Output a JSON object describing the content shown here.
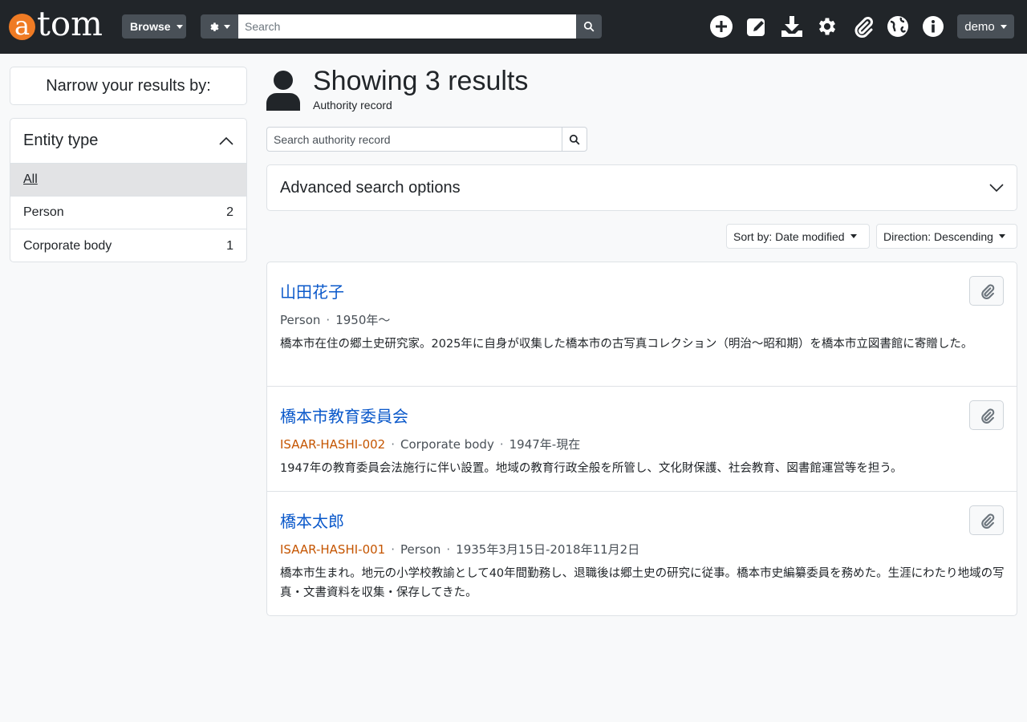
{
  "header": {
    "logo_letter": "a",
    "logo_text": "tom",
    "browse_label": "Browse",
    "search_placeholder": "Search",
    "user_label": "demo",
    "icons": [
      "plus-circle-icon",
      "edit-icon",
      "download-icon",
      "gear-icon",
      "paperclip-icon",
      "globe-icon",
      "info-icon"
    ]
  },
  "sidebar": {
    "narrow_label": "Narrow your results by:",
    "facet": {
      "title": "Entity type",
      "items": [
        {
          "label": "All",
          "count": ""
        },
        {
          "label": "Person",
          "count": "2"
        },
        {
          "label": "Corporate body",
          "count": "1"
        }
      ]
    }
  },
  "main": {
    "title": "Showing 3 results",
    "subtitle": "Authority record",
    "search_placeholder": "Search authority record",
    "advanced_label": "Advanced search options",
    "sort_label": "Sort by: Date modified",
    "direction_label": "Direction: Descending",
    "results": [
      {
        "title": "山田花子",
        "ref": "",
        "type": "Person",
        "dates": "1950年〜",
        "description": "橋本市在住の郷土史研究家。2025年に自身が収集した橋本市の古写真コレクション（明治〜昭和期）を橋本市立図書館に寄贈した。"
      },
      {
        "title": "橋本市教育委員会",
        "ref": "ISAAR-HASHI-002",
        "type": "Corporate body",
        "dates": "1947年-現在",
        "description": "1947年の教育委員会法施行に伴い設置。地域の教育行政全般を所管し、文化財保護、社会教育、図書館運営等を担う。"
      },
      {
        "title": "橋本太郎",
        "ref": "ISAAR-HASHI-001",
        "type": "Person",
        "dates": "1935年3月15日-2018年11月2日",
        "description": "橋本市生まれ。地元の小学校教諭として40年間勤務し、退職後は郷土史の研究に従事。橋本市史編纂委員を務めた。生涯にわたり地域の写真・文書資料を収集・保存してきた。"
      }
    ]
  },
  "colors": {
    "topbar": "#212529",
    "logo_accent": "#ef7b24",
    "link": "#0a58ca",
    "reference": "#c55500"
  }
}
